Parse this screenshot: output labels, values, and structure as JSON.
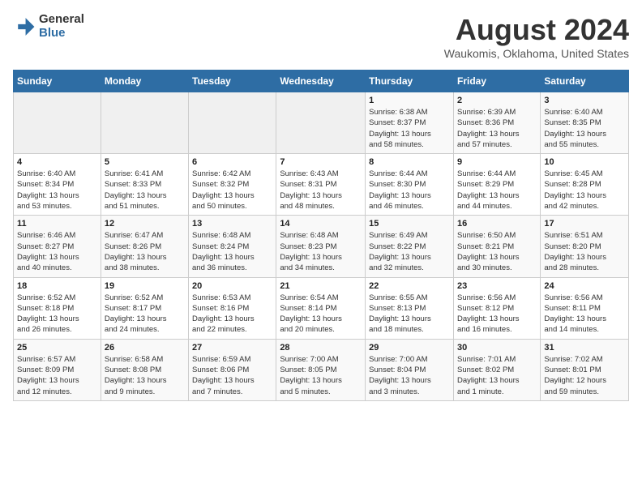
{
  "header": {
    "logo_general": "General",
    "logo_blue": "Blue",
    "month_title": "August 2024",
    "location": "Waukomis, Oklahoma, United States"
  },
  "days_of_week": [
    "Sunday",
    "Monday",
    "Tuesday",
    "Wednesday",
    "Thursday",
    "Friday",
    "Saturday"
  ],
  "weeks": [
    [
      {
        "day": "",
        "info": ""
      },
      {
        "day": "",
        "info": ""
      },
      {
        "day": "",
        "info": ""
      },
      {
        "day": "",
        "info": ""
      },
      {
        "day": "1",
        "info": "Sunrise: 6:38 AM\nSunset: 8:37 PM\nDaylight: 13 hours\nand 58 minutes."
      },
      {
        "day": "2",
        "info": "Sunrise: 6:39 AM\nSunset: 8:36 PM\nDaylight: 13 hours\nand 57 minutes."
      },
      {
        "day": "3",
        "info": "Sunrise: 6:40 AM\nSunset: 8:35 PM\nDaylight: 13 hours\nand 55 minutes."
      }
    ],
    [
      {
        "day": "4",
        "info": "Sunrise: 6:40 AM\nSunset: 8:34 PM\nDaylight: 13 hours\nand 53 minutes."
      },
      {
        "day": "5",
        "info": "Sunrise: 6:41 AM\nSunset: 8:33 PM\nDaylight: 13 hours\nand 51 minutes."
      },
      {
        "day": "6",
        "info": "Sunrise: 6:42 AM\nSunset: 8:32 PM\nDaylight: 13 hours\nand 50 minutes."
      },
      {
        "day": "7",
        "info": "Sunrise: 6:43 AM\nSunset: 8:31 PM\nDaylight: 13 hours\nand 48 minutes."
      },
      {
        "day": "8",
        "info": "Sunrise: 6:44 AM\nSunset: 8:30 PM\nDaylight: 13 hours\nand 46 minutes."
      },
      {
        "day": "9",
        "info": "Sunrise: 6:44 AM\nSunset: 8:29 PM\nDaylight: 13 hours\nand 44 minutes."
      },
      {
        "day": "10",
        "info": "Sunrise: 6:45 AM\nSunset: 8:28 PM\nDaylight: 13 hours\nand 42 minutes."
      }
    ],
    [
      {
        "day": "11",
        "info": "Sunrise: 6:46 AM\nSunset: 8:27 PM\nDaylight: 13 hours\nand 40 minutes."
      },
      {
        "day": "12",
        "info": "Sunrise: 6:47 AM\nSunset: 8:26 PM\nDaylight: 13 hours\nand 38 minutes."
      },
      {
        "day": "13",
        "info": "Sunrise: 6:48 AM\nSunset: 8:24 PM\nDaylight: 13 hours\nand 36 minutes."
      },
      {
        "day": "14",
        "info": "Sunrise: 6:48 AM\nSunset: 8:23 PM\nDaylight: 13 hours\nand 34 minutes."
      },
      {
        "day": "15",
        "info": "Sunrise: 6:49 AM\nSunset: 8:22 PM\nDaylight: 13 hours\nand 32 minutes."
      },
      {
        "day": "16",
        "info": "Sunrise: 6:50 AM\nSunset: 8:21 PM\nDaylight: 13 hours\nand 30 minutes."
      },
      {
        "day": "17",
        "info": "Sunrise: 6:51 AM\nSunset: 8:20 PM\nDaylight: 13 hours\nand 28 minutes."
      }
    ],
    [
      {
        "day": "18",
        "info": "Sunrise: 6:52 AM\nSunset: 8:18 PM\nDaylight: 13 hours\nand 26 minutes."
      },
      {
        "day": "19",
        "info": "Sunrise: 6:52 AM\nSunset: 8:17 PM\nDaylight: 13 hours\nand 24 minutes."
      },
      {
        "day": "20",
        "info": "Sunrise: 6:53 AM\nSunset: 8:16 PM\nDaylight: 13 hours\nand 22 minutes."
      },
      {
        "day": "21",
        "info": "Sunrise: 6:54 AM\nSunset: 8:14 PM\nDaylight: 13 hours\nand 20 minutes."
      },
      {
        "day": "22",
        "info": "Sunrise: 6:55 AM\nSunset: 8:13 PM\nDaylight: 13 hours\nand 18 minutes."
      },
      {
        "day": "23",
        "info": "Sunrise: 6:56 AM\nSunset: 8:12 PM\nDaylight: 13 hours\nand 16 minutes."
      },
      {
        "day": "24",
        "info": "Sunrise: 6:56 AM\nSunset: 8:11 PM\nDaylight: 13 hours\nand 14 minutes."
      }
    ],
    [
      {
        "day": "25",
        "info": "Sunrise: 6:57 AM\nSunset: 8:09 PM\nDaylight: 13 hours\nand 12 minutes."
      },
      {
        "day": "26",
        "info": "Sunrise: 6:58 AM\nSunset: 8:08 PM\nDaylight: 13 hours\nand 9 minutes."
      },
      {
        "day": "27",
        "info": "Sunrise: 6:59 AM\nSunset: 8:06 PM\nDaylight: 13 hours\nand 7 minutes."
      },
      {
        "day": "28",
        "info": "Sunrise: 7:00 AM\nSunset: 8:05 PM\nDaylight: 13 hours\nand 5 minutes."
      },
      {
        "day": "29",
        "info": "Sunrise: 7:00 AM\nSunset: 8:04 PM\nDaylight: 13 hours\nand 3 minutes."
      },
      {
        "day": "30",
        "info": "Sunrise: 7:01 AM\nSunset: 8:02 PM\nDaylight: 13 hours\nand 1 minute."
      },
      {
        "day": "31",
        "info": "Sunrise: 7:02 AM\nSunset: 8:01 PM\nDaylight: 12 hours\nand 59 minutes."
      }
    ]
  ]
}
